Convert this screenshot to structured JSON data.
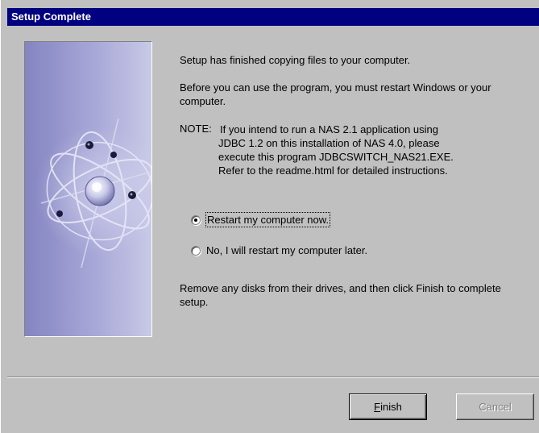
{
  "window": {
    "title": "Setup Complete"
  },
  "side_panel": {
    "image": "atom-orbit-graphic"
  },
  "messages": {
    "copied": "Setup has finished copying files to your computer.",
    "restart_needed": "Before you can use the program, you must restart Windows or your computer.",
    "note_label": "NOTE:",
    "note_lines": [
      "If you intend to run a NAS 2.1 application using",
      "JDBC 1.2 on this installation of NAS 4.0, please",
      "execute this program JDBCSWITCH_NAS21.EXE.",
      "Refer to the readme.html for detailed instructions."
    ],
    "remove_disks": "Remove any disks from their drives, and then click Finish to complete setup."
  },
  "options": [
    {
      "label": "Restart my computer now.",
      "selected": true
    },
    {
      "label": "No, I will restart my computer later.",
      "selected": false
    }
  ],
  "buttons": {
    "finish_mnemonic": "F",
    "finish_rest": "inish",
    "cancel": "Cancel",
    "cancel_enabled": false
  },
  "colors": {
    "titlebar": "#000080",
    "background": "#c0c0c0",
    "panel": "#8f8fc8"
  }
}
